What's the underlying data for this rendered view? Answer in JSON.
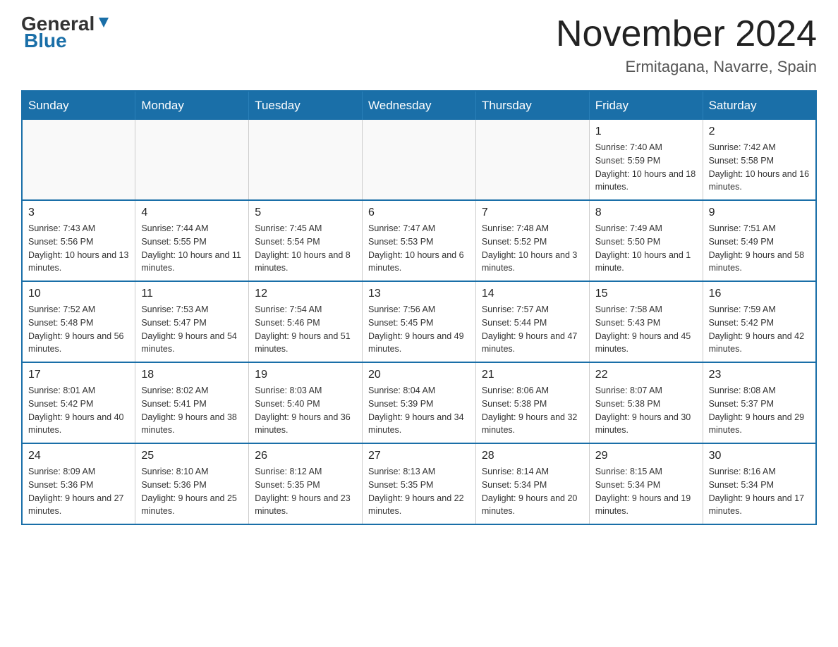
{
  "header": {
    "logo_general": "General",
    "logo_blue": "Blue",
    "month_title": "November 2024",
    "location": "Ermitagana, Navarre, Spain"
  },
  "weekdays": [
    "Sunday",
    "Monday",
    "Tuesday",
    "Wednesday",
    "Thursday",
    "Friday",
    "Saturday"
  ],
  "weeks": [
    [
      {
        "day": "",
        "info": ""
      },
      {
        "day": "",
        "info": ""
      },
      {
        "day": "",
        "info": ""
      },
      {
        "day": "",
        "info": ""
      },
      {
        "day": "",
        "info": ""
      },
      {
        "day": "1",
        "info": "Sunrise: 7:40 AM\nSunset: 5:59 PM\nDaylight: 10 hours and 18 minutes."
      },
      {
        "day": "2",
        "info": "Sunrise: 7:42 AM\nSunset: 5:58 PM\nDaylight: 10 hours and 16 minutes."
      }
    ],
    [
      {
        "day": "3",
        "info": "Sunrise: 7:43 AM\nSunset: 5:56 PM\nDaylight: 10 hours and 13 minutes."
      },
      {
        "day": "4",
        "info": "Sunrise: 7:44 AM\nSunset: 5:55 PM\nDaylight: 10 hours and 11 minutes."
      },
      {
        "day": "5",
        "info": "Sunrise: 7:45 AM\nSunset: 5:54 PM\nDaylight: 10 hours and 8 minutes."
      },
      {
        "day": "6",
        "info": "Sunrise: 7:47 AM\nSunset: 5:53 PM\nDaylight: 10 hours and 6 minutes."
      },
      {
        "day": "7",
        "info": "Sunrise: 7:48 AM\nSunset: 5:52 PM\nDaylight: 10 hours and 3 minutes."
      },
      {
        "day": "8",
        "info": "Sunrise: 7:49 AM\nSunset: 5:50 PM\nDaylight: 10 hours and 1 minute."
      },
      {
        "day": "9",
        "info": "Sunrise: 7:51 AM\nSunset: 5:49 PM\nDaylight: 9 hours and 58 minutes."
      }
    ],
    [
      {
        "day": "10",
        "info": "Sunrise: 7:52 AM\nSunset: 5:48 PM\nDaylight: 9 hours and 56 minutes."
      },
      {
        "day": "11",
        "info": "Sunrise: 7:53 AM\nSunset: 5:47 PM\nDaylight: 9 hours and 54 minutes."
      },
      {
        "day": "12",
        "info": "Sunrise: 7:54 AM\nSunset: 5:46 PM\nDaylight: 9 hours and 51 minutes."
      },
      {
        "day": "13",
        "info": "Sunrise: 7:56 AM\nSunset: 5:45 PM\nDaylight: 9 hours and 49 minutes."
      },
      {
        "day": "14",
        "info": "Sunrise: 7:57 AM\nSunset: 5:44 PM\nDaylight: 9 hours and 47 minutes."
      },
      {
        "day": "15",
        "info": "Sunrise: 7:58 AM\nSunset: 5:43 PM\nDaylight: 9 hours and 45 minutes."
      },
      {
        "day": "16",
        "info": "Sunrise: 7:59 AM\nSunset: 5:42 PM\nDaylight: 9 hours and 42 minutes."
      }
    ],
    [
      {
        "day": "17",
        "info": "Sunrise: 8:01 AM\nSunset: 5:42 PM\nDaylight: 9 hours and 40 minutes."
      },
      {
        "day": "18",
        "info": "Sunrise: 8:02 AM\nSunset: 5:41 PM\nDaylight: 9 hours and 38 minutes."
      },
      {
        "day": "19",
        "info": "Sunrise: 8:03 AM\nSunset: 5:40 PM\nDaylight: 9 hours and 36 minutes."
      },
      {
        "day": "20",
        "info": "Sunrise: 8:04 AM\nSunset: 5:39 PM\nDaylight: 9 hours and 34 minutes."
      },
      {
        "day": "21",
        "info": "Sunrise: 8:06 AM\nSunset: 5:38 PM\nDaylight: 9 hours and 32 minutes."
      },
      {
        "day": "22",
        "info": "Sunrise: 8:07 AM\nSunset: 5:38 PM\nDaylight: 9 hours and 30 minutes."
      },
      {
        "day": "23",
        "info": "Sunrise: 8:08 AM\nSunset: 5:37 PM\nDaylight: 9 hours and 29 minutes."
      }
    ],
    [
      {
        "day": "24",
        "info": "Sunrise: 8:09 AM\nSunset: 5:36 PM\nDaylight: 9 hours and 27 minutes."
      },
      {
        "day": "25",
        "info": "Sunrise: 8:10 AM\nSunset: 5:36 PM\nDaylight: 9 hours and 25 minutes."
      },
      {
        "day": "26",
        "info": "Sunrise: 8:12 AM\nSunset: 5:35 PM\nDaylight: 9 hours and 23 minutes."
      },
      {
        "day": "27",
        "info": "Sunrise: 8:13 AM\nSunset: 5:35 PM\nDaylight: 9 hours and 22 minutes."
      },
      {
        "day": "28",
        "info": "Sunrise: 8:14 AM\nSunset: 5:34 PM\nDaylight: 9 hours and 20 minutes."
      },
      {
        "day": "29",
        "info": "Sunrise: 8:15 AM\nSunset: 5:34 PM\nDaylight: 9 hours and 19 minutes."
      },
      {
        "day": "30",
        "info": "Sunrise: 8:16 AM\nSunset: 5:34 PM\nDaylight: 9 hours and 17 minutes."
      }
    ]
  ]
}
